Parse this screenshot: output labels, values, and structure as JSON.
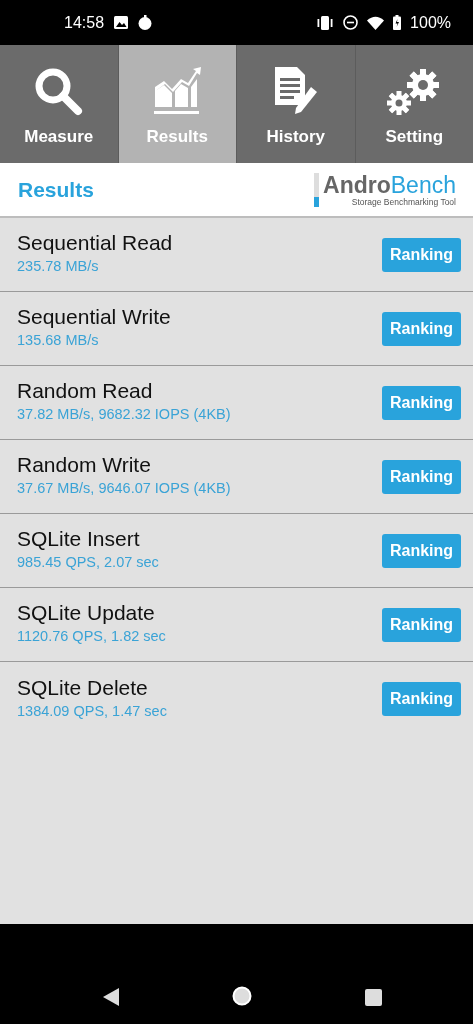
{
  "status_bar": {
    "time": "14:58",
    "battery": "100%"
  },
  "tabs": [
    {
      "label": "Measure",
      "selected": false
    },
    {
      "label": "Results",
      "selected": true
    },
    {
      "label": "History",
      "selected": false
    },
    {
      "label": "Setting",
      "selected": false
    }
  ],
  "header": {
    "title": "Results",
    "logo": "**Andro**Bench",
    "tagline": "Storage Benchmarking Tool"
  },
  "results": [
    {
      "name": "Sequential Read",
      "value": "235.78 MB/s",
      "button": "Ranking"
    },
    {
      "name": "Sequential Write",
      "value": "135.68 MB/s",
      "button": "Ranking"
    },
    {
      "name": "Random Read",
      "value": "37.82 MB/s, 9682.32 IOPS (4KB)",
      "button": "Ranking"
    },
    {
      "name": "Random Write",
      "value": "37.67 MB/s, 9646.07 IOPS (4KB)",
      "button": "Ranking"
    },
    {
      "name": "SQLite Insert",
      "value": "985.45 QPS, 2.07 sec",
      "button": "Ranking"
    },
    {
      "name": "SQLite Update",
      "value": "1120.76 QPS, 1.82 sec",
      "button": "Ranking"
    },
    {
      "name": "SQLite Delete",
      "value": "1384.09 QPS, 1.47 sec",
      "button": "Ranking"
    }
  ]
}
